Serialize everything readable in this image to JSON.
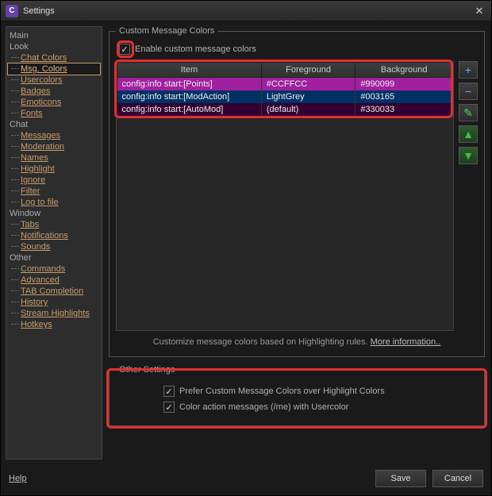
{
  "window": {
    "title": "Settings",
    "icon_letter": "C"
  },
  "sidebar": {
    "categories": [
      {
        "label": "Main",
        "items": []
      },
      {
        "label": "Look",
        "items": [
          {
            "label": "Chat Colors"
          },
          {
            "label": "Msg. Colors",
            "selected": true
          },
          {
            "label": "Usercolors"
          },
          {
            "label": "Badges"
          },
          {
            "label": "Emoticons"
          },
          {
            "label": "Fonts"
          }
        ]
      },
      {
        "label": "Chat",
        "items": [
          {
            "label": "Messages"
          },
          {
            "label": "Moderation"
          },
          {
            "label": "Names"
          },
          {
            "label": "Highlight"
          },
          {
            "label": "Ignore"
          },
          {
            "label": "Filter"
          },
          {
            "label": "Log to file"
          }
        ]
      },
      {
        "label": "Window",
        "items": [
          {
            "label": "Tabs"
          },
          {
            "label": "Notifications"
          },
          {
            "label": "Sounds"
          }
        ]
      },
      {
        "label": "Other",
        "items": [
          {
            "label": "Commands"
          },
          {
            "label": "Advanced"
          },
          {
            "label": "TAB Completion"
          },
          {
            "label": "History"
          },
          {
            "label": "Stream Highlights"
          },
          {
            "label": "Hotkeys"
          }
        ]
      }
    ]
  },
  "groups": {
    "custom_colors": {
      "legend": "Custom Message Colors",
      "enable_label": "Enable custom message colors",
      "headers": {
        "item": "Item",
        "fg": "Foreground",
        "bg": "Background"
      },
      "rows": [
        {
          "item": "config:info start:[Points]",
          "fg": "#CCFFCC",
          "bg": "#990099",
          "row_bg": "#a020a0",
          "row_fg": "#d6ffd6"
        },
        {
          "item": "config:info start:[ModAction]",
          "fg": "LightGrey",
          "bg": "#003165",
          "row_bg": "#003165",
          "row_fg": "#d0d0d0"
        },
        {
          "item": "config:info start:[AutoMod]",
          "fg": "(default)",
          "bg": "#330033",
          "row_bg": "#330033",
          "row_fg": "#cfcfcf"
        }
      ],
      "footer": "Customize message colors based on Highlighting rules.",
      "footer_link": "More information.."
    },
    "other": {
      "legend": "Other Settings",
      "prefer_label": "Prefer Custom Message Colors over Highlight Colors",
      "action_label": "Color action messages (/me) with Usercolor"
    }
  },
  "buttons": {
    "help": "Help",
    "save": "Save",
    "cancel": "Cancel"
  },
  "side_icons": {
    "add": "+",
    "remove": "−",
    "edit": "✎",
    "up": "▲",
    "down": "▼"
  }
}
